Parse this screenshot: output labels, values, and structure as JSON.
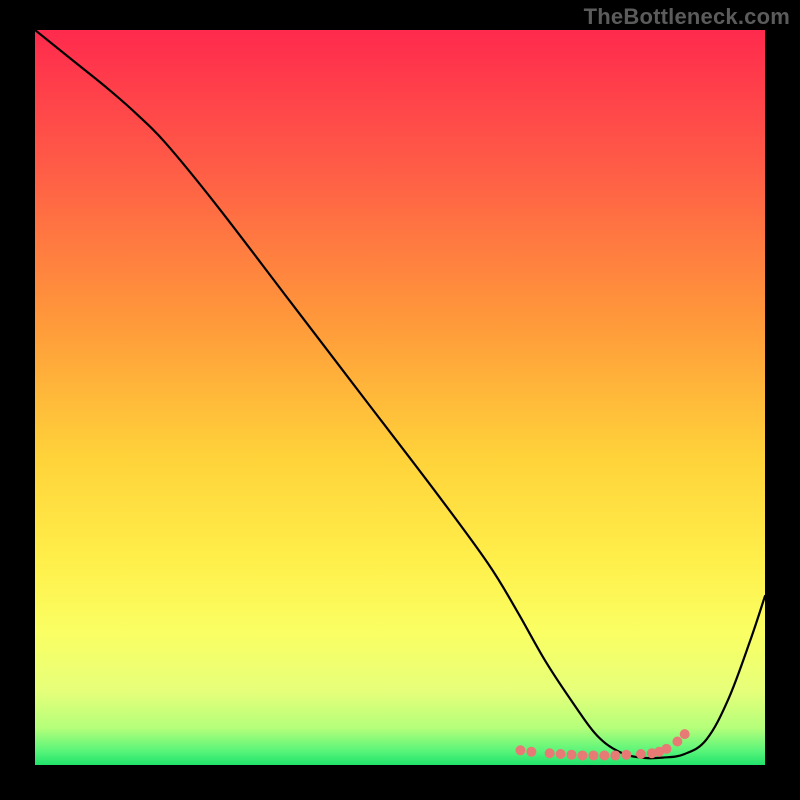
{
  "watermark": "TheBottleneck.com",
  "chart_data": {
    "type": "line",
    "title": "",
    "xlabel": "",
    "ylabel": "",
    "xlim": [
      0,
      100
    ],
    "ylim": [
      0,
      100
    ],
    "grid": false,
    "legend": false,
    "background": {
      "gradient_stops": [
        {
          "offset": 0,
          "color": "#ff2a4d"
        },
        {
          "offset": 18,
          "color": "#ff5a47"
        },
        {
          "offset": 40,
          "color": "#ff9a3a"
        },
        {
          "offset": 58,
          "color": "#ffd23a"
        },
        {
          "offset": 72,
          "color": "#ffef4a"
        },
        {
          "offset": 82,
          "color": "#faff63"
        },
        {
          "offset": 90,
          "color": "#e6ff7a"
        },
        {
          "offset": 95,
          "color": "#b4ff7a"
        },
        {
          "offset": 98,
          "color": "#5cf57a"
        },
        {
          "offset": 100,
          "color": "#21e36b"
        }
      ]
    },
    "series": [
      {
        "name": "curve",
        "stroke": "#000000",
        "stroke_width": 2.2,
        "x": [
          0,
          5,
          10,
          14,
          18,
          25,
          35,
          45,
          55,
          62,
          66,
          70,
          74,
          77,
          80,
          83,
          86,
          89,
          92,
          95,
          98,
          100
        ],
        "y": [
          100,
          96,
          92,
          88.5,
          84.5,
          76,
          63,
          50,
          37,
          27.5,
          21,
          14,
          8,
          4,
          1.8,
          1,
          1,
          1.5,
          3.5,
          9,
          17,
          23
        ]
      }
    ],
    "markers": {
      "name": "bottom-dots",
      "color": "#e77a74",
      "radius": 5,
      "x": [
        66.5,
        68,
        70.5,
        72,
        73.5,
        75,
        76.5,
        78,
        79.5,
        81,
        83,
        84.5,
        85.5,
        86.5,
        88,
        89
      ],
      "y": [
        2,
        1.8,
        1.6,
        1.5,
        1.4,
        1.3,
        1.3,
        1.3,
        1.3,
        1.4,
        1.5,
        1.6,
        1.8,
        2.2,
        3.2,
        4.2
      ]
    }
  }
}
